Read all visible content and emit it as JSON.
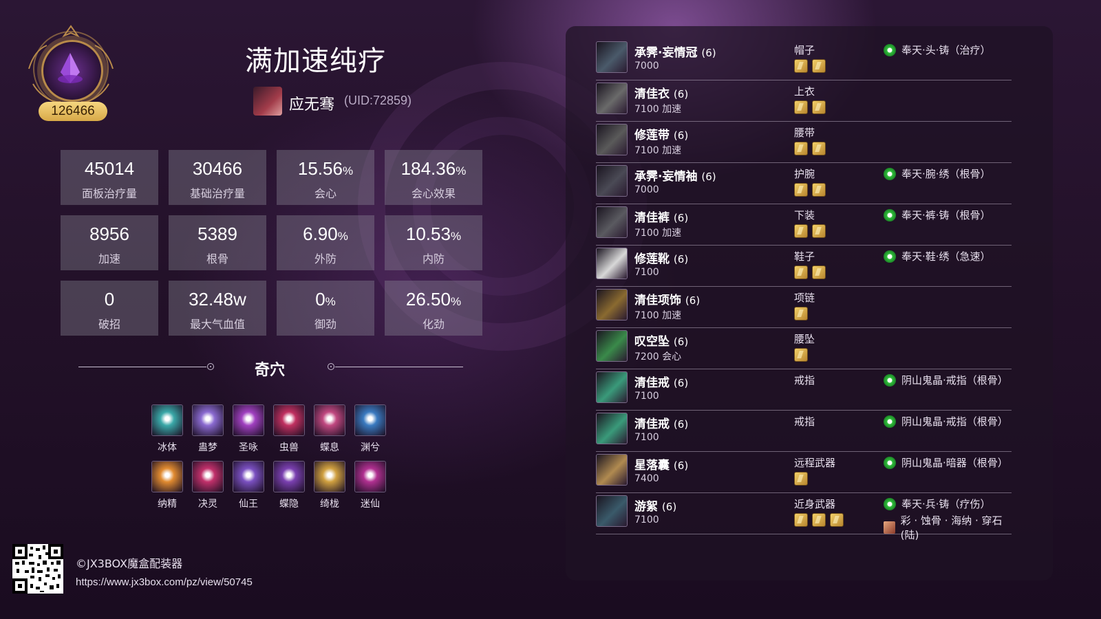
{
  "badge": {
    "score": "126466"
  },
  "title": "满加速纯疗",
  "player": {
    "name": "应无骞",
    "uid": "(UID:72859)"
  },
  "stats": [
    {
      "value": "45014",
      "unit": "",
      "label": "面板治疗量"
    },
    {
      "value": "30466",
      "unit": "",
      "label": "基础治疗量"
    },
    {
      "value": "15.56",
      "unit": "%",
      "label": "会心"
    },
    {
      "value": "184.36",
      "unit": "%",
      "label": "会心效果"
    },
    {
      "value": "8956",
      "unit": "",
      "label": "加速"
    },
    {
      "value": "5389",
      "unit": "",
      "label": "根骨"
    },
    {
      "value": "6.90",
      "unit": "%",
      "label": "外防"
    },
    {
      "value": "10.53",
      "unit": "%",
      "label": "内防"
    },
    {
      "value": "0",
      "unit": "",
      "label": "破招"
    },
    {
      "value": "32.48w",
      "unit": "",
      "label": "最大气血值"
    },
    {
      "value": "0",
      "unit": "%",
      "label": "御劲"
    },
    {
      "value": "26.50",
      "unit": "%",
      "label": "化劲"
    }
  ],
  "qixue": {
    "title": "奇穴",
    "skills": [
      {
        "name": "冰体",
        "color": "#3aa8a8"
      },
      {
        "name": "蛊梦",
        "color": "#8a6ad0"
      },
      {
        "name": "圣咏",
        "color": "#a040c0"
      },
      {
        "name": "虫兽",
        "color": "#c03060"
      },
      {
        "name": "蝶息",
        "color": "#c04880"
      },
      {
        "name": "渊兮",
        "color": "#3a7ac0"
      },
      {
        "name": "纳精",
        "color": "#e08a30"
      },
      {
        "name": "决灵",
        "color": "#c0306a"
      },
      {
        "name": "仙王",
        "color": "#7a50c0"
      },
      {
        "name": "蝶隐",
        "color": "#7a40b0"
      },
      {
        "name": "绮栊",
        "color": "#d0a040"
      },
      {
        "name": "迷仙",
        "color": "#b03090"
      }
    ]
  },
  "footer": {
    "copyright": "©JX3BOX魔盒配装器",
    "url": "https://www.jx3box.com/pz/view/50745"
  },
  "equipment": [
    {
      "name": "承霁·妄情冠",
      "level": "(6)",
      "score": "7000",
      "slot": "帽子",
      "gems": 2,
      "enchant": "奉天·头·铸（治疗）",
      "enchant2": "",
      "color": "#4a5a6a"
    },
    {
      "name": "清佳衣",
      "level": "(6)",
      "score": "7100 加速",
      "slot": "上衣",
      "gems": 2,
      "enchant": "",
      "enchant2": "",
      "color": "#6a6a6a"
    },
    {
      "name": "修莲带",
      "level": "(6)",
      "score": "7100 加速",
      "slot": "腰带",
      "gems": 2,
      "enchant": "",
      "enchant2": "",
      "color": "#5a5a5a"
    },
    {
      "name": "承霁·妄情袖",
      "level": "(6)",
      "score": "7000",
      "slot": "护腕",
      "gems": 2,
      "enchant": "奉天·腕·绣（根骨）",
      "enchant2": "",
      "color": "#4a4a55"
    },
    {
      "name": "清佳裤",
      "level": "(6)",
      "score": "7100 加速",
      "slot": "下装",
      "gems": 2,
      "enchant": "奉天·裤·铸（根骨）",
      "enchant2": "",
      "color": "#5a5a60"
    },
    {
      "name": "修莲靴",
      "level": "(6)",
      "score": "7100",
      "slot": "鞋子",
      "gems": 2,
      "enchant": "奉天·鞋·绣（急速）",
      "enchant2": "",
      "color": "#d8d8d8"
    },
    {
      "name": "清佳项饰",
      "level": "(6)",
      "score": "7100 加速",
      "slot": "项链",
      "gems": 1,
      "enchant": "",
      "enchant2": "",
      "color": "#8a6a30"
    },
    {
      "name": "叹空坠",
      "level": "(6)",
      "score": "7200 会心",
      "slot": "腰坠",
      "gems": 1,
      "enchant": "",
      "enchant2": "",
      "color": "#3a8a4a"
    },
    {
      "name": "清佳戒",
      "level": "(6)",
      "score": "7100",
      "slot": "戒指",
      "gems": 0,
      "enchant": "阴山鬼晶·戒指（根骨）",
      "enchant2": "",
      "color": "#3a9a7a"
    },
    {
      "name": "清佳戒",
      "level": "(6)",
      "score": "7100",
      "slot": "戒指",
      "gems": 0,
      "enchant": "阴山鬼晶·戒指（根骨）",
      "enchant2": "",
      "color": "#3a9a7a"
    },
    {
      "name": "星落囊",
      "level": "(6)",
      "score": "7400",
      "slot": "远程武器",
      "gems": 1,
      "enchant": "阴山鬼晶·暗器（根骨）",
      "enchant2": "",
      "color": "#b08a50"
    },
    {
      "name": "游絮",
      "level": "(6)",
      "score": "7100",
      "slot": "近身武器",
      "gems": 3,
      "enchant": "奉天·兵·铸（疗伤）",
      "enchant2": "彩 · 蚀骨 · 海纳 · 穿石(陆)",
      "color": "#3a5a6a"
    }
  ]
}
